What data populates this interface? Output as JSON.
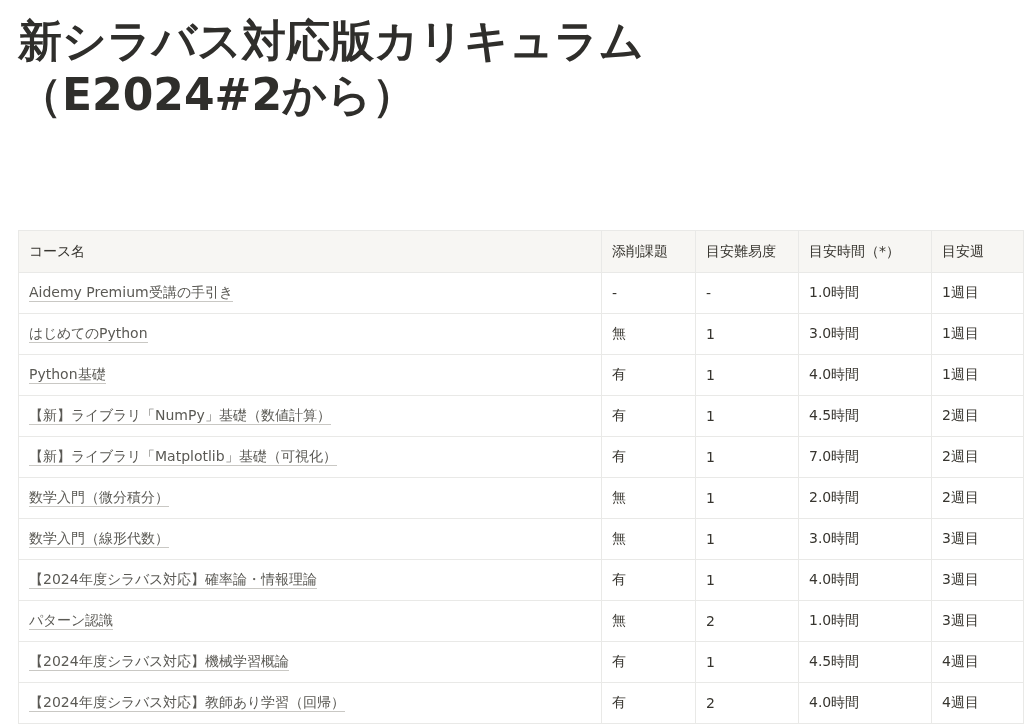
{
  "title": "新シラバス対応版カリキュラム（E2024#2から）",
  "table": {
    "columns": [
      "コース名",
      "添削課題",
      "目安難易度",
      "目安時間（*）",
      "目安週"
    ],
    "rows": [
      {
        "course": "Aidemy Premium受講の手引き",
        "assignment": "-",
        "difficulty": "-",
        "hours": "1.0時間",
        "week": "1週目"
      },
      {
        "course": "はじめてのPython",
        "assignment": "無",
        "difficulty": "1",
        "hours": "3.0時間",
        "week": "1週目"
      },
      {
        "course": "Python基礎",
        "assignment": "有",
        "difficulty": "1",
        "hours": "4.0時間",
        "week": "1週目"
      },
      {
        "course": "【新】ライブラリ「NumPy」基礎（数値計算）",
        "assignment": "有",
        "difficulty": "1",
        "hours": "4.5時間",
        "week": "2週目"
      },
      {
        "course": "【新】ライブラリ「Matplotlib」基礎（可視化）",
        "assignment": "有",
        "difficulty": "1",
        "hours": "7.0時間",
        "week": "2週目"
      },
      {
        "course": "数学入門（微分積分）",
        "assignment": "無",
        "difficulty": "1",
        "hours": "2.0時間",
        "week": "2週目"
      },
      {
        "course": "数学入門（線形代数）",
        "assignment": "無",
        "difficulty": "1",
        "hours": "3.0時間",
        "week": "3週目"
      },
      {
        "course": "【2024年度シラバス対応】確率論・情報理論",
        "assignment": "有",
        "difficulty": "1",
        "hours": "4.0時間",
        "week": "3週目"
      },
      {
        "course": "パターン認識",
        "assignment": "無",
        "difficulty": "2",
        "hours": "1.0時間",
        "week": "3週目"
      },
      {
        "course": "【2024年度シラバス対応】機械学習概論",
        "assignment": "有",
        "difficulty": "1",
        "hours": "4.5時間",
        "week": "4週目"
      },
      {
        "course": "【2024年度シラバス対応】教師あり学習（回帰）",
        "assignment": "有",
        "difficulty": "2",
        "hours": "4.0時間",
        "week": "4週目"
      }
    ]
  }
}
